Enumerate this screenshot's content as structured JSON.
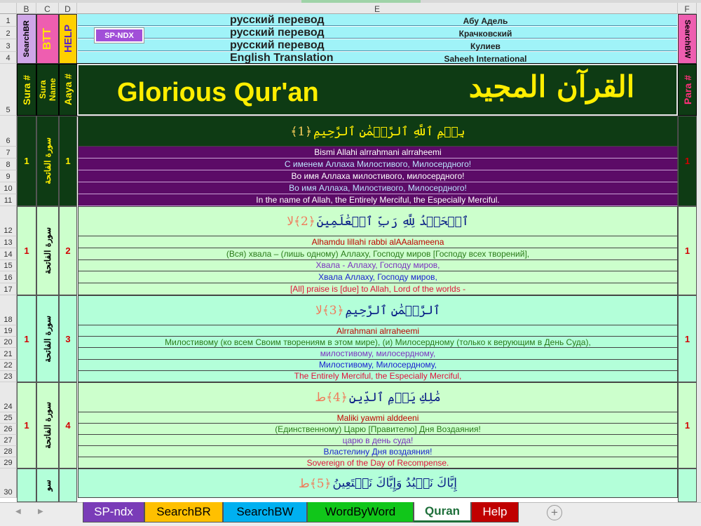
{
  "columns": {
    "b": "B",
    "c": "C",
    "d": "D",
    "e": "E",
    "f": "F"
  },
  "header_row_numbers": [
    "1",
    "2",
    "3",
    "4",
    "5"
  ],
  "side_buttons": {
    "search_br": "SearchBR",
    "btt": "BTT",
    "help": "HELP",
    "search_bw": "SearchBW"
  },
  "sp_ndx_button": "SP-NDX",
  "translations": [
    {
      "title": "русский перевод",
      "author": "Абу Адель"
    },
    {
      "title": "русский перевод",
      "author": "Крачковский"
    },
    {
      "title": "русский перевод",
      "author": "Кулиев"
    },
    {
      "title": "English Translation",
      "author": "Saheeh International"
    }
  ],
  "col_headers": {
    "sura_num": "Sura #",
    "sura_name": "Sura Name",
    "aaya_num": "Aaya #",
    "para_num": "Para #"
  },
  "banner": {
    "english": "Glorious Qur'an",
    "arabic": "القرآن المجيد"
  },
  "ayat": [
    {
      "rows": [
        "6",
        "7",
        "8",
        "9",
        "10",
        "11"
      ],
      "sura": "1",
      "sura_name": "سورة الفاتحة",
      "aaya": "1",
      "para": "1",
      "arabic": "بِسۡمِ ٱللَّهِ ٱلرَّحۡمَٰنِ ٱلرَّحِيمِ",
      "marker": "﴿1﴾",
      "lines": [
        "Bismi Allahi alrrahmani alrraheemi",
        "С именем Аллаха Милостивого, Милосердного!",
        "Во имя Аллаха милостивого, милосердного!",
        "Во имя Аллаха, Милостивого, Милосердного!",
        "In the name of Allah, the Entirely Merciful, the Especially Merciful."
      ]
    },
    {
      "rows": [
        "12",
        "13",
        "14",
        "15",
        "16",
        "17"
      ],
      "sura": "1",
      "sura_name": "سورة الفاتحة",
      "aaya": "2",
      "para": "1",
      "arabic": "ٱلۡحَمۡدُ لِلَّهِ رَبِّ ٱلۡعَٰلَمِينَ",
      "marker": "﴿2﴾لا",
      "lines": [
        "Alhamdu lillahi rabbi alAAalameena",
        "(Вся) хвала – (лишь одному) Аллаху, Господу миров [Господу всех творений],",
        "Хвала - Аллаху, Господу миров,",
        "Хвала Аллаху, Господу миров,",
        "[All] praise is [due] to Allah, Lord of the worlds -"
      ]
    },
    {
      "rows": [
        "18",
        "19",
        "20",
        "21",
        "22",
        "23"
      ],
      "sura": "1",
      "sura_name": "سورة الفاتحة",
      "aaya": "3",
      "para": "1",
      "arabic": "ٱلرَّحۡمَٰنِ ٱلرَّحِيمِ",
      "marker": "﴿3﴾لا",
      "lines": [
        "Alrrahmani alrraheemi",
        "Милостивому (ко всем Своим творениям в этом мире), (и) Милосердному (только к верующим в День Суда),",
        "милостивому, милосердному,",
        "Милостивому, Милосердному,",
        "The Entirely Merciful, the Especially Merciful,"
      ]
    },
    {
      "rows": [
        "24",
        "25",
        "26",
        "27",
        "28",
        "29"
      ],
      "sura": "1",
      "sura_name": "سورة الفاتحة",
      "aaya": "4",
      "para": "1",
      "arabic": "مَٰلِكِ يَوۡمِ ٱلدِّينِ",
      "marker": "﴿4﴾ط",
      "lines": [
        "Maliki yawmi alddeeni",
        "(Единственному) Царю [Правителю] Дня Воздаяния!",
        "царю в день суда!",
        "Властелину Дня воздаяния!",
        "Sovereign of the Day of Recompense."
      ]
    },
    {
      "rows": [
        "30"
      ],
      "sura": "",
      "sura_name": "سو",
      "aaya": "",
      "para": "",
      "arabic": "إِيَّاكَ نَعۡبُدُ وَإِيَّاكَ نَسۡتَعِينُ",
      "marker": "﴿5﴾ط",
      "lines": []
    }
  ],
  "tabs": [
    "SP-ndx",
    "SearchBR",
    "SearchBW",
    "WordByWord",
    "Quran",
    "Help"
  ],
  "active_tab": "Quran",
  "colors": {
    "green_block": "#0e3b14",
    "purple": "#5c0b67",
    "light_green": "#ccffcc",
    "light_mint": "#b3ffd9",
    "cyan": "#a0f3f8",
    "gold": "#ffee00",
    "red_text": "#d10000"
  }
}
